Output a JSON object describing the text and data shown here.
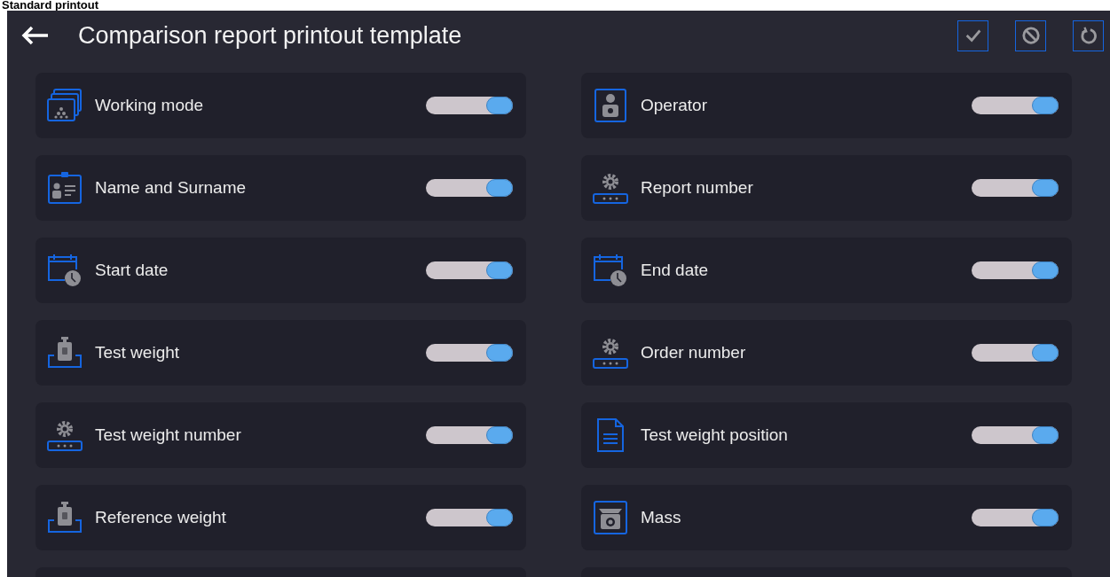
{
  "heading": "Standard printout",
  "header": {
    "title": "Comparison report printout template",
    "actions": [
      {
        "kind": "confirm"
      },
      {
        "kind": "cancel"
      },
      {
        "kind": "reset"
      }
    ]
  },
  "items": [
    {
      "label": "Working mode",
      "kind": "mode",
      "on": true
    },
    {
      "label": "Operator",
      "kind": "operator",
      "on": true
    },
    {
      "label": "Name and Surname",
      "kind": "idcard",
      "on": true
    },
    {
      "label": "Report number",
      "kind": "counter",
      "on": true
    },
    {
      "label": "Start date",
      "kind": "calendar",
      "on": true
    },
    {
      "label": "End date",
      "kind": "calendar",
      "on": true
    },
    {
      "label": "Test weight",
      "kind": "weight",
      "on": true
    },
    {
      "label": "Order number",
      "kind": "counter",
      "on": true
    },
    {
      "label": "Test weight number",
      "kind": "counter",
      "on": true
    },
    {
      "label": "Test weight position",
      "kind": "document",
      "on": true
    },
    {
      "label": "Reference weight",
      "kind": "weight",
      "on": true
    },
    {
      "label": "Mass",
      "kind": "scale",
      "on": true
    }
  ]
}
